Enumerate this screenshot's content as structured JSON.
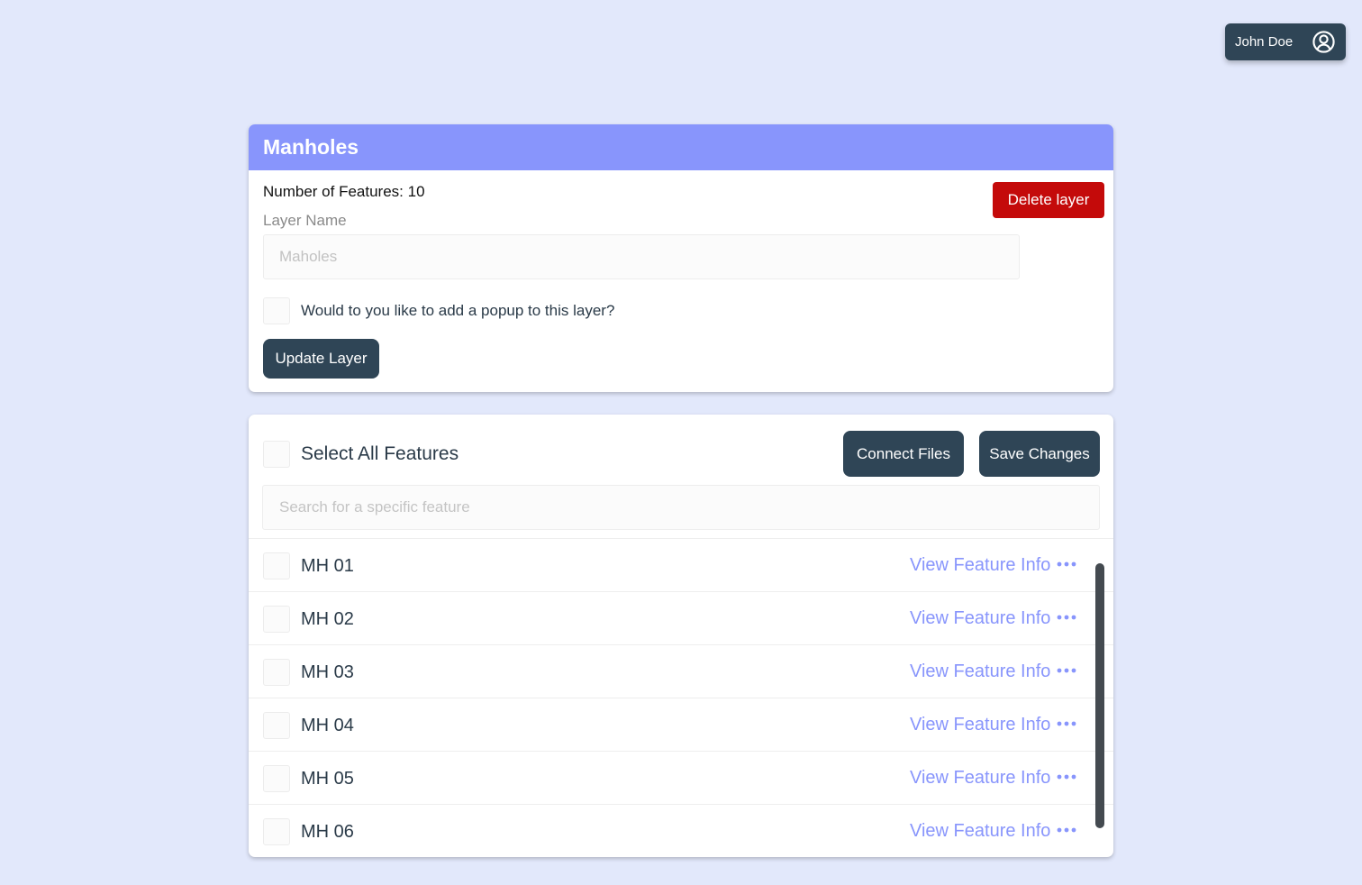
{
  "user": {
    "name": "John Doe",
    "icon": "user-circle-icon"
  },
  "layer": {
    "title": "Manholes",
    "features_count_text": "Number of Features: 10",
    "delete_label": "Delete layer",
    "name_label": "Layer Name",
    "name_placeholder": "Maholes",
    "popup_question": "Would to you like to add a popup to this layer?",
    "update_label": "Update Layer"
  },
  "features": {
    "select_all_label": "Select All Features",
    "connect_label": "Connect Files",
    "save_label": "Save Changes",
    "search_placeholder": "Search for a specific feature",
    "view_label": "View Feature Info",
    "items": [
      {
        "name": "MH 01"
      },
      {
        "name": "MH 02"
      },
      {
        "name": "MH 03"
      },
      {
        "name": "MH 04"
      },
      {
        "name": "MH 05"
      },
      {
        "name": "MH 06"
      }
    ]
  },
  "colors": {
    "background": "#e2e8fb",
    "header": "#8895fc",
    "dark_button": "#2f4556",
    "danger": "#c40a0a",
    "link": "#8895fc"
  }
}
